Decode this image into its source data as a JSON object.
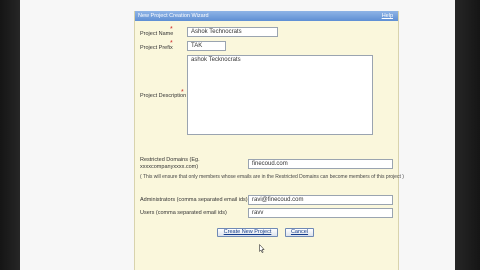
{
  "wizard": {
    "title": "New Project Creation Wizard",
    "help_label": "Help"
  },
  "form": {
    "project_name": {
      "label": "Project Name",
      "required_mark": "*",
      "value": "Ashok Technocrats"
    },
    "project_prefix": {
      "label": "Project Prefix",
      "required_mark": "*",
      "value": "TAK"
    },
    "project_description": {
      "label": "Project Description",
      "required_mark": "*",
      "value": "ashok Tecknocrats"
    },
    "restricted_domains": {
      "label_line1": "Restricted Domains (Eg.",
      "label_line2": "xxxxcompanyxxxx.com)",
      "value": "finecoud.com",
      "note": "( This will ensure that only members whose emails are in the Restricted Domains can become members of this project )"
    },
    "administrators": {
      "label": "Administrators (comma separated email ids)",
      "value": "ravi@finecoud.com"
    },
    "users": {
      "label": "Users (comma separated email ids)",
      "value": "ravv"
    }
  },
  "buttons": {
    "create_label": "Create New Project",
    "cancel_label": "Cancel"
  }
}
